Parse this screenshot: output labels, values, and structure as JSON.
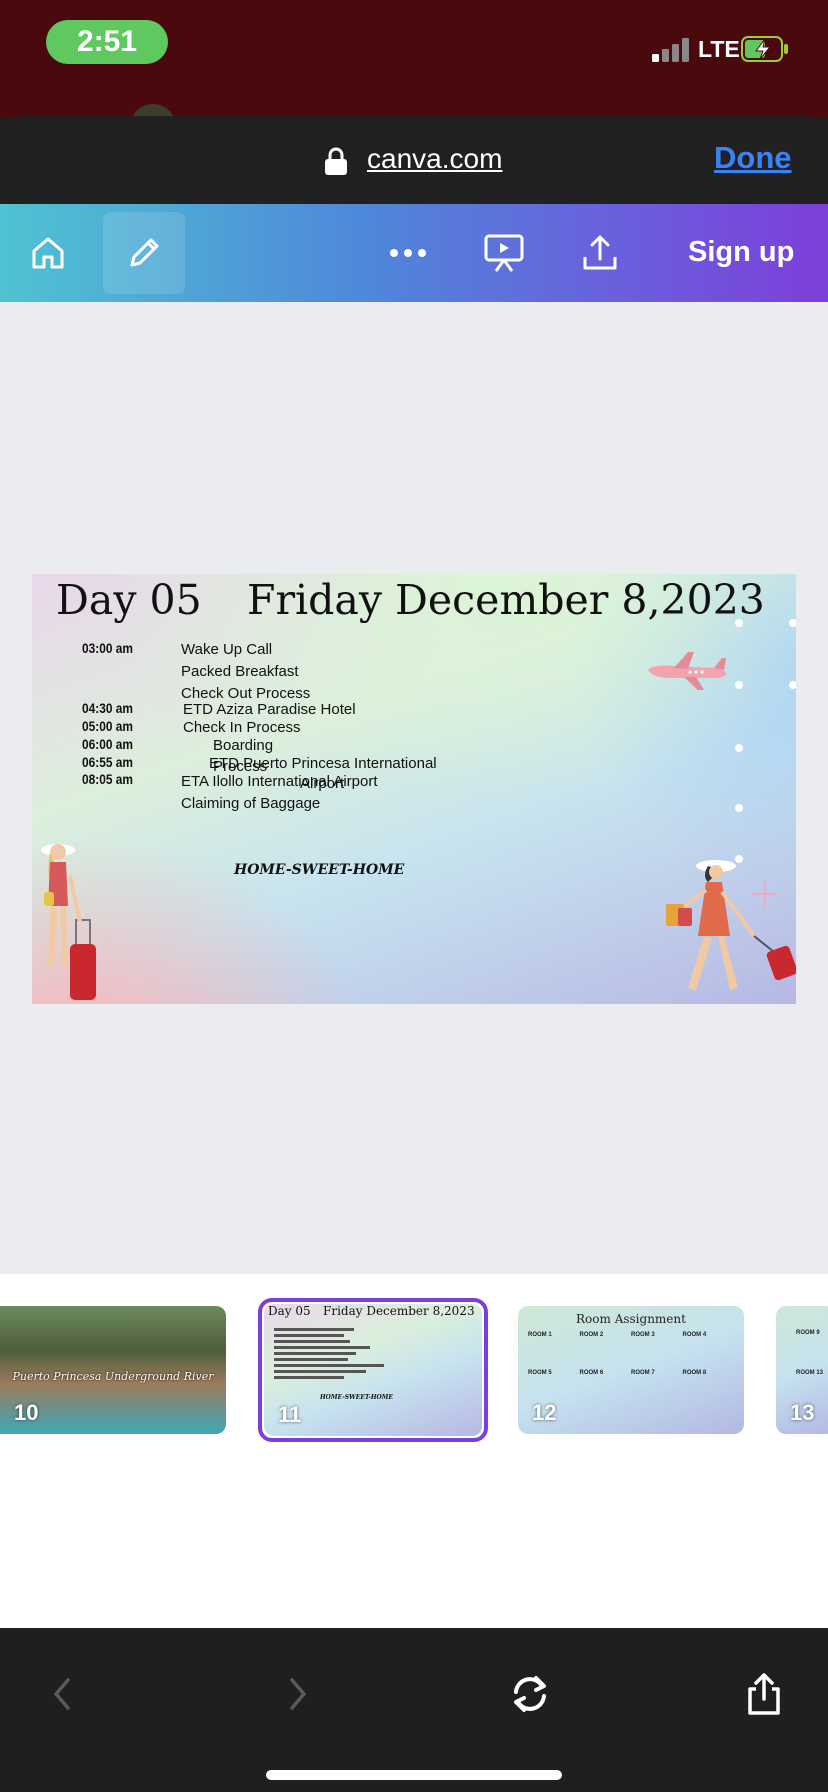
{
  "status_bar": {
    "time": "2:51",
    "network": "LTE"
  },
  "browser": {
    "url": "canva.com",
    "done_label": "Done"
  },
  "toolbar": {
    "signup_label": "Sign up"
  },
  "slide": {
    "day": "Day 05",
    "date": "Friday December 8,2023",
    "times": [
      "03:00 am",
      "04:30 am",
      "05:00 am",
      "06:00 am",
      "06:55 am",
      "08:05 am"
    ],
    "activities": [
      "Wake Up Call",
      "Packed Breakfast",
      "Check Out Process",
      "ETD Aziza Paradise Hotel",
      "Check In Process",
      "Boarding",
      "Process",
      "ETD Puerto Princesa International",
      "ETA Ilollo International Airport",
      "Airport",
      "Claiming of Baggage"
    ],
    "footer": "HOME-SWEET-HOME"
  },
  "thumbnails": [
    {
      "number": "10",
      "caption": "Puerto Princesa Underground River"
    },
    {
      "number": "11",
      "day": "Day 05",
      "date": "Friday December 8,2023",
      "footer": "HOME-SWEET-HOME"
    },
    {
      "number": "12",
      "title": "Room Assignment",
      "rooms": [
        "ROOM 1",
        "ROOM 2",
        "ROOM 3",
        "ROOM 4",
        "ROOM 5",
        "ROOM 6",
        "ROOM 7",
        "ROOM 8"
      ]
    },
    {
      "number": "13",
      "rooms": [
        "ROOM 9",
        "ROOM 13"
      ]
    }
  ],
  "colors": {
    "accent": "#7d3fd9",
    "done": "#3b82f6",
    "status_bg": "#4a0a0d",
    "time_pill": "#5fc85f"
  }
}
